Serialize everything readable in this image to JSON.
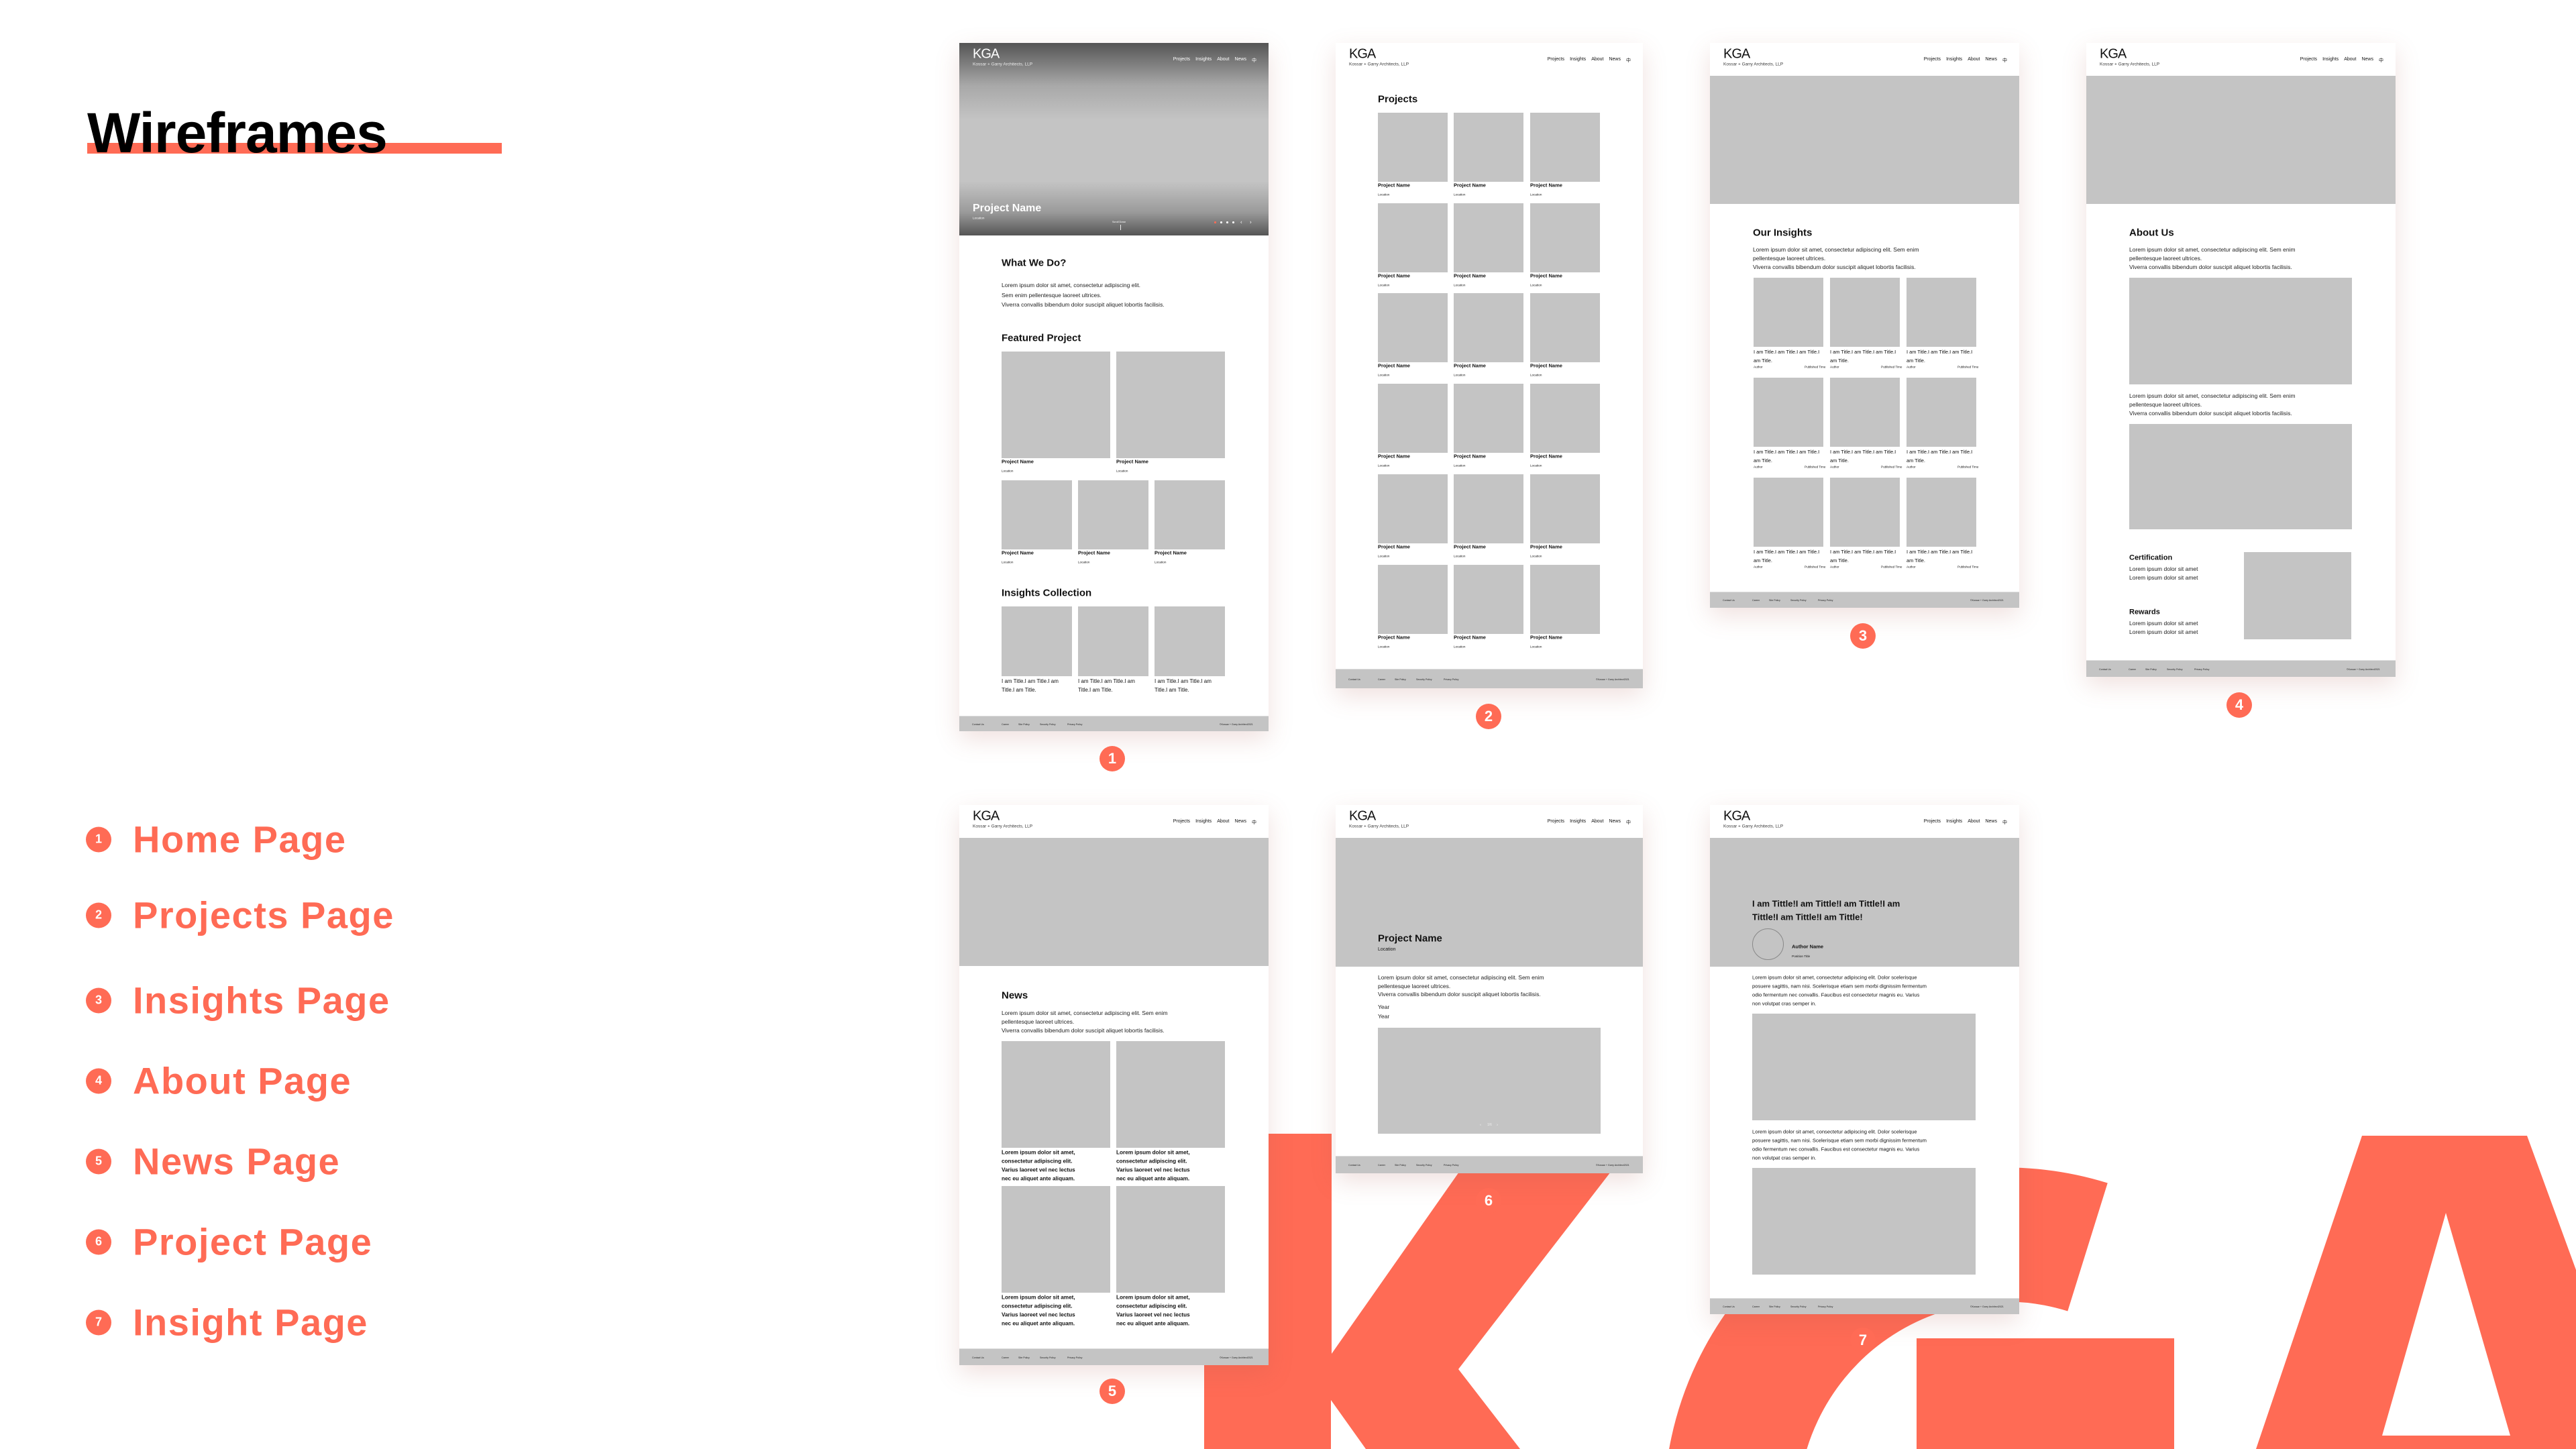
{
  "title": "Wireframes",
  "colors": {
    "accent": "#FF6B55",
    "placeholder": "#C4C4C4",
    "footer": "#C4C4C4"
  },
  "legend": [
    {
      "num": "1",
      "label": "Home Page"
    },
    {
      "num": "2",
      "label": "Projects Page"
    },
    {
      "num": "3",
      "label": "Insights Page"
    },
    {
      "num": "4",
      "label": "About Page"
    },
    {
      "num": "5",
      "label": "News Page"
    },
    {
      "num": "6",
      "label": "Project Page"
    },
    {
      "num": "7",
      "label": "Insight Page"
    }
  ],
  "background_logo": "KGA",
  "site": {
    "logo": "KGA",
    "tagline": "Kossar + Garry Architects, LLP",
    "nav": [
      "Projects",
      "Insights",
      "About",
      "News"
    ],
    "lang_icon": "中",
    "footer_links": [
      "Contact Us",
      "Career",
      "Site Policy",
      "Security Policy",
      "Privacy Policy"
    ],
    "copyright": "©Kossar + Garry Architect2021"
  },
  "pages": {
    "home": {
      "hero_title": "Project Name",
      "hero_location": "Location",
      "scroll_label": "Scroll Down",
      "slider_prev": "‹",
      "slider_next": "›",
      "what_title": "What We Do?",
      "what_lines": [
        "Lorem ipsum dolor sit amet, consectetur adipiscing elit.",
        "Sem enim pellentesque laoreet ultrices.",
        "Viverra convallis bibendum dolor suscipit aliquet lobortis facilisis."
      ],
      "featured_title": "Featured Project",
      "featured": [
        {
          "name": "Project Name",
          "location": "Location"
        },
        {
          "name": "Project Name",
          "location": "Location"
        },
        {
          "name": "Project Name",
          "location": "Location"
        },
        {
          "name": "Project Name",
          "location": "Location"
        },
        {
          "name": "Project Name",
          "location": "Location"
        }
      ],
      "insights_title": "Insights Collection",
      "insights": [
        {
          "title": "I am Title.I am Title.I am Title.I am Title."
        },
        {
          "title": "I am Title.I am Title.I am Title.I am Title."
        },
        {
          "title": "I am Title.I am Title.I am Title.I am Title."
        }
      ]
    },
    "projects": {
      "title": "Projects",
      "items": [
        {
          "name": "Project Name",
          "location": "Location"
        },
        {
          "name": "Project Name",
          "location": "Location"
        },
        {
          "name": "Project Name",
          "location": "Location"
        },
        {
          "name": "Project Name",
          "location": "Location"
        },
        {
          "name": "Project Name",
          "location": "Location"
        },
        {
          "name": "Project Name",
          "location": "Location"
        },
        {
          "name": "Project Name",
          "location": "Location"
        },
        {
          "name": "Project Name",
          "location": "Location"
        },
        {
          "name": "Project Name",
          "location": "Location"
        },
        {
          "name": "Project Name",
          "location": "Location"
        },
        {
          "name": "Project Name",
          "location": "Location"
        },
        {
          "name": "Project Name",
          "location": "Location"
        },
        {
          "name": "Project Name",
          "location": "Location"
        },
        {
          "name": "Project Name",
          "location": "Location"
        },
        {
          "name": "Project Name",
          "location": "Location"
        },
        {
          "name": "Project Name",
          "location": "Location"
        },
        {
          "name": "Project Name",
          "location": "Location"
        },
        {
          "name": "Project Name",
          "location": "Location"
        }
      ]
    },
    "insights": {
      "title": "Our Insights",
      "lines": [
        "Lorem ipsum dolor sit amet, consectetur adipiscing elit. Sem enim",
        "pellentesque laoreet ultrices.",
        "Viverra convallis bibendum dolor suscipit aliquet lobortis facilisis."
      ],
      "items": [
        {
          "title": "I am Title.I am Title.I am Title.I am Title.",
          "author": "Author",
          "time": "Published Time"
        },
        {
          "title": "I am Title.I am Title.I am Title.I am Title.",
          "author": "Author",
          "time": "Published Time"
        },
        {
          "title": "I am Title.I am Title.I am Title.I am Title.",
          "author": "Author",
          "time": "Published Time"
        },
        {
          "title": "I am Title.I am Title.I am Title.I am Title.",
          "author": "Author",
          "time": "Published Time"
        },
        {
          "title": "I am Title.I am Title.I am Title.I am Title.",
          "author": "Author",
          "time": "Published Time"
        },
        {
          "title": "I am Title.I am Title.I am Title.I am Title.",
          "author": "Author",
          "time": "Published Time"
        },
        {
          "title": "I am Title.I am Title.I am Title.I am Title.",
          "author": "Author",
          "time": "Published Time"
        },
        {
          "title": "I am Title.I am Title.I am Title.I am Title.",
          "author": "Author",
          "time": "Published Time"
        },
        {
          "title": "I am Title.I am Title.I am Title.I am Title.",
          "author": "Author",
          "time": "Published Time"
        }
      ]
    },
    "about": {
      "title": "About Us",
      "lines": [
        "Lorem ipsum dolor sit amet, consectetur adipiscing elit. Sem enim",
        "pellentesque laoreet ultrices.",
        "Viverra convallis bibendum dolor suscipit aliquet lobortis facilisis."
      ],
      "lines2": [
        "Lorem ipsum dolor sit amet, consectetur adipiscing elit. Sem enim",
        "pellentesque laoreet ultrices.",
        "Viverra convallis bibendum dolor suscipit aliquet lobortis facilisis."
      ],
      "cert_title": "Certification",
      "cert_lines": [
        "Lorem ipsum dolor sit amet",
        "Lorem ipsum dolor sit amet"
      ],
      "rewards_title": "Rewards",
      "rewards_lines": [
        "Lorem ipsum dolor sit amet",
        "Lorem ipsum dolor sit amet"
      ]
    },
    "news": {
      "title": "News",
      "lines": [
        "Lorem ipsum dolor sit amet, consectetur adipiscing elit. Sem enim",
        "pellentesque laoreet ultrices.",
        "Viverra convallis bibendum dolor suscipit aliquet lobortis facilisis."
      ],
      "items": [
        {
          "lines": [
            "Lorem ipsum dolor sit amet,",
            "consectetur adipiscing elit.",
            "Varius laoreet vel nec lectus",
            "nec eu aliquet ante aliquam."
          ]
        },
        {
          "lines": [
            "Lorem ipsum dolor sit amet,",
            "consectetur adipiscing elit.",
            "Varius laoreet vel nec lectus",
            "nec eu aliquet ante aliquam."
          ]
        },
        {
          "lines": [
            "Lorem ipsum dolor sit amet,",
            "consectetur adipiscing elit.",
            "Varius laoreet vel nec lectus",
            "nec eu aliquet ante aliquam."
          ]
        },
        {
          "lines": [
            "Lorem ipsum dolor sit amet,",
            "consectetur adipiscing elit.",
            "Varius laoreet vel nec lectus",
            "nec eu aliquet ante aliquam."
          ]
        }
      ]
    },
    "project": {
      "title": "Project Name",
      "location": "Location",
      "lines": [
        "Lorem ipsum dolor sit amet, consectetur adipiscing elit. Sem enim",
        "pellentesque laoreet ultrices.",
        "Viverra convallis bibendum dolor suscipit aliquet lobortis facilisis."
      ],
      "years": [
        "Year",
        "Year"
      ],
      "gallery_prev": "‹",
      "gallery_counter": "1/6",
      "gallery_next": "›"
    },
    "insight": {
      "title_lines": [
        "I am Tittle!I am Tittle!I am Tittle!I am",
        "Tittle!I am Tittle!I am Tittle!"
      ],
      "author": "Author Name",
      "position": "Position Title",
      "para1": [
        "Lorem ipsum dolor sit amet, consectetur adipiscing elit. Dolor scelerisque",
        "posuere sagittis, nam nisi. Scelerisque etiam sem morbi dignissim fermentum",
        "odio fermentum nec convallis. Faucibus est consectetur magnis eu. Varius",
        "non volutpat cras semper in."
      ],
      "para2": [
        "Lorem ipsum dolor sit amet, consectetur adipiscing elit. Dolor scelerisque",
        "posuere sagittis, nam nisi. Scelerisque etiam sem morbi dignissim fermentum",
        "odio fermentum nec convallis. Faucibus est consectetur magnis eu. Varius",
        "non volutpat cras semper in."
      ]
    }
  }
}
